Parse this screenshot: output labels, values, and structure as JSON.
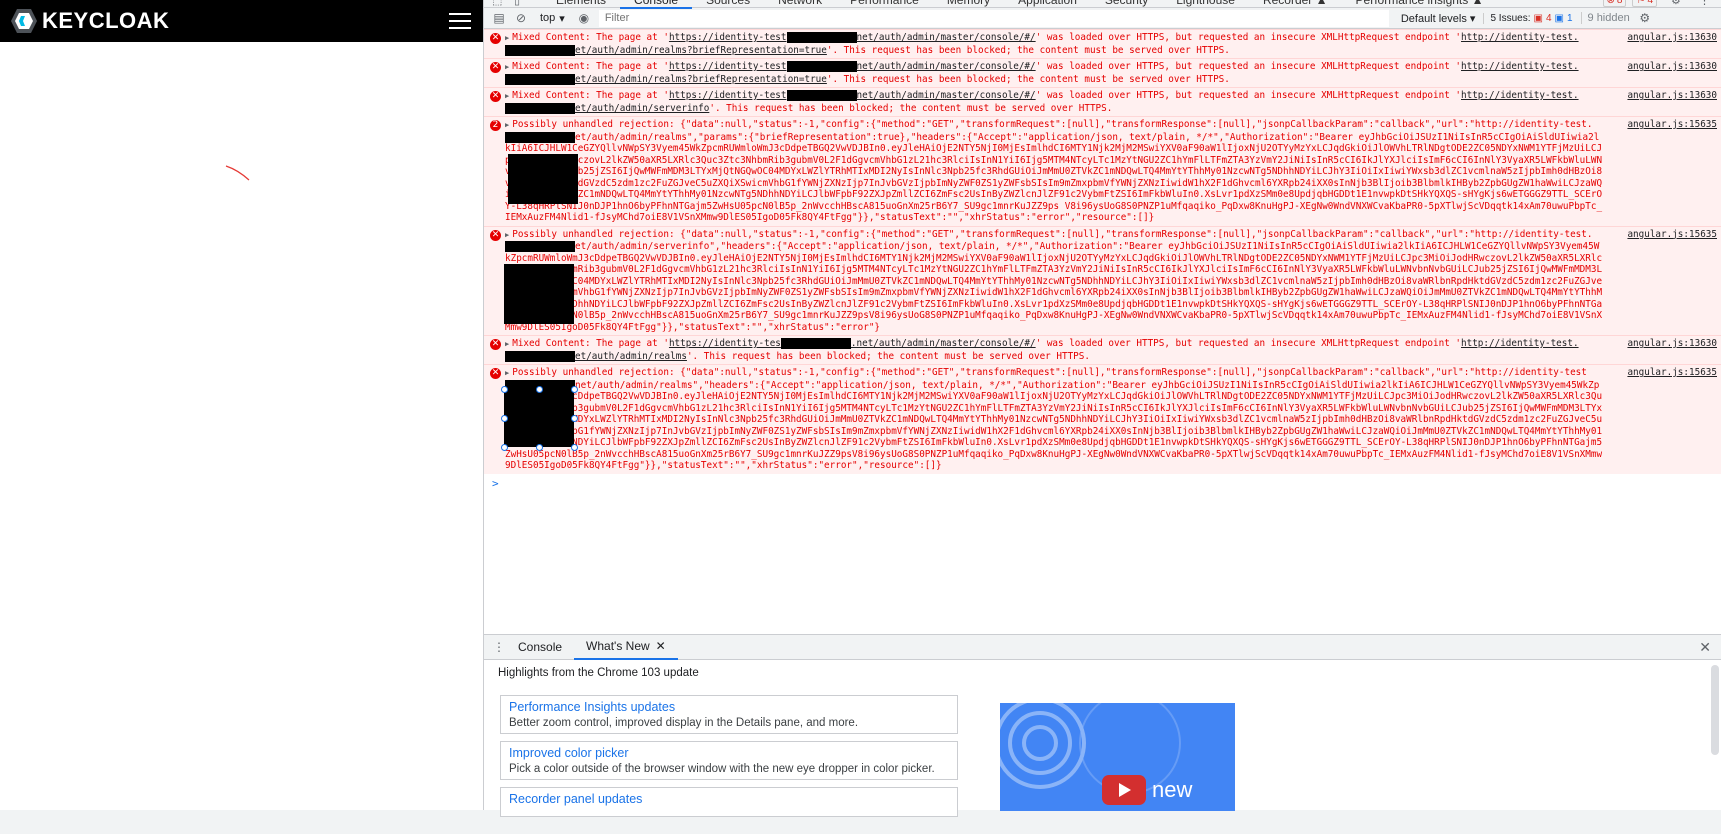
{
  "app": {
    "brand": "KEYCLOAK"
  },
  "devtools": {
    "tabs": [
      "Elements",
      "Console",
      "Sources",
      "Network",
      "Performance",
      "Memory",
      "Application",
      "Security",
      "Lighthouse",
      "Recorder ▲",
      "Performance insights ▲"
    ],
    "active_tab": "Console",
    "error_count": "8",
    "warning_count": "4",
    "toolbar": {
      "context": "top",
      "filter_placeholder": "Filter",
      "levels": "Default levels",
      "issues_label": "5 Issues:",
      "issues_errors": "4",
      "issues_info": "1",
      "hidden": "9 hidden"
    },
    "messages": [
      {
        "type": "error",
        "text_a": "Mixed Content: The page at '",
        "url_a": "https://identity-test",
        "url_b": "net/auth/admin/master/console/#/",
        "text_b": "' was loaded over HTTPS, but requested an insecure XMLHttpRequest endpoint '",
        "url_c": "http://identity-test.",
        "url_d": "et/auth/admin/realms?briefRepresentation=true",
        "text_c": "'. This request has been blocked; the content must be served over HTTPS.",
        "source": "angular.js:13630"
      },
      {
        "type": "error",
        "text_a": "Mixed Content: The page at '",
        "url_a": "https://identity-test",
        "url_b": "net/auth/admin/master/console/#/",
        "text_b": "' was loaded over HTTPS, but requested an insecure XMLHttpRequest endpoint '",
        "url_c": "http://identity-test.",
        "url_d": "et/auth/admin/realms?briefRepresentation=true",
        "text_c": "'. This request has been blocked; the content must be served over HTTPS.",
        "source": "angular.js:13630"
      },
      {
        "type": "error",
        "text_a": "Mixed Content: The page at '",
        "url_a": "https://identity-test",
        "url_b": "net/auth/admin/master/console/#/",
        "text_b": "' was loaded over HTTPS, but requested an insecure XMLHttpRequest endpoint '",
        "url_c": "http://identity-test.",
        "url_d": "et/auth/admin/serverinfo",
        "text_c": "'. This request has been blocked; the content must be served over HTTPS.",
        "source": "angular.js:13630"
      },
      {
        "type": "rejection",
        "repeat": "2",
        "head": "Possibly unhandled rejection: {\"data\":null,\"status\":-1,\"config\":{\"method\":\"GET\",\"transformRequest\":[null],\"transformResponse\":[null],\"jsonpCallbackParam\":\"callback\",\"url\":\"http://identity-test.",
        "mid": "et/auth/admin/realms\",\"params\":{\"briefRepresentation\":true},\"headers\":{\"Accept\":\"application/json, text/plain, */*\",\"Authorization\":\"Bearer eyJhbGciOiJSUzI1NiIsInR5cCIgOiAiSldUIiwia2lkIiA6ICJHLW1CeGZYQllvNWpSY3Vyem45WkZpcmRUWmloWmJ3cDdpeTBGQ2VwVDJBIn0.eyJleHAiOjE2NTY5NjI0MjEsImlhdCI6MTY1Njk2MjM2MSwiYXV0aF90aW1lIjoxNjU2OTYyMzYxLCJqdGkiOiJlOWVhLTRlNDgtODE2ZC05NDYxNWM1YTFjMzUiLCJpc3MiOiJodHRwczovL2lkZW50aXR5LXRlc3Quc3Ztc3NhbmRib3gubmV0L2F1dGgvcmVhbG1zL21hc3RlciIsInN1YiI6Ijg5MTM4NTcyLTc1MzYtNGU2ZC1hYmFlLTFmZTA3YzVmY2JiNiIsInR5cCI6IkJlYXJlciIsImF6cCI6InNlY3VyaXR5LWFkbWluLWNvbnNvbGUiLCJub25jZSI6IjQwMWFmMDM3LTYxMjQtNGQwOC04MDYxLWZlYTRhMTIxMDI2NyIsInNlc3Npb25fc3RhdGUiOiJmMmU0ZTVkZC1mNDQwLTQ4MmYtYThhMy01NzcwNTg5NDhhNDYiLCJhY3IiOiIxIiwiYWxsb3dlZC1vcmlnaW5zIjpbImh0dHBzOi8vaWRlbnRpdHktdGVzdC5zdm1zc2FuZGJveC5uZXQiXSwicmVhbG1fYWNjZXNzIjp7InJvbGVzIjpbImNyZWF0ZS1yZWFsbSIsIm9mZmxpbmVfYWNjZXNzIiwidW1hX2F1dGhvcml6YXRpb24iXX0sInNjb3BlIjoib3BlbmlkIHByb2ZpbGUgZW1haWwiLCJzaWQiOiJmMmU0ZTVkZC1mNDQwLTQ4MmYtYThhMy01NzcwNTg5NDhhNDYiLCJlbWFpbF92ZXJpZmllZCI6ZmFsc2UsInByZWZlcnJlZF91c2VybmFtZSI6ImFkbWluIn0.XsLvr1pdXzSMm0e8Updjqb",
        "tail": "HGDDt1E1nvwpkDtSHkYQXQS-sHYgKjs6wETGGGZ9TTL_SCErOY-L38qHRPlSNIJ0nDJP1hnO6byPFhnNTGajm5ZwHsU05pcN0lB5p_2nWvcchHBscA815uoGnXm25rB6Y7_SU9gc1mnrKuJZZ9ps V8i96ysUoG8S0PNZP1uMfqaqiko_PqDxw8KnuHgPJ-XEgNw0WndVNXWCvaKbaPR0-5pXTlwjScVDqqtk14xAm70uwuPbpTc_IEMxAuzFM4Nlid1-fJsyMChd7oiE8V1VSnXMmw9DlES05IgoD05Fk8QY4FtFgg\"}},\"statusText\":\"\",\"xhrStatus\":\"error\",\"resource\":[]}",
        "source": "angular.js:15635"
      },
      {
        "type": "rejection",
        "repeat": "",
        "head": "Possibly unhandled rejection: {\"data\":null,\"status\":-1,\"config\":{\"method\":\"GET\",\"transformRequest\":[null],\"transformResponse\":[null],\"jsonpCallbackParam\":\"callback\",\"url\":\"http://identity-test.",
        "mid": "et/auth/admin/serverinfo\",\"headers\":{\"Accept\":\"application/json, text/plain, */*\",\"Authorization\":\"Bearer eyJhbGciOiJSUzI1NiIsInR5cCIgOiAiSldUIiwia2lkIiA6ICJHLW1CeGZYQllvNWpSY3Vyem45WkZpcmRUWmloWmJ3cDdpeTBGQ2VwVDJBIn0.eyJleHAiOjE2NTY5NjI0MjEsImlhdCI6MTY1Njk2MjM2MSwiYXV0aF90aW1lIjoxNjU2OTYyMzYxLCJqdGkiOiJlOWVhLTRlNDgtODE2ZC05NDYxNWM1YTFjMzUiLCJpc3MiOiJodHRwczovL2lkZW50aXR5LXRlc3Quc3Ztc3NhbmRib3gubmV0L2F1dGgvcmVhbG1zL21hc3RlciIsInN1YiI6Ijg5MTM4NTcyLTc1MzYtNGU2ZC1hYmFlLTFmZTA3YzVmY2JiNiIsInR5cCI6IkJlYXJlciIsImF6cCI6InNlY3VyaXR5LWFkbWluLWNvbnNvbGUiLCJub25jZSI6IjQwMWFmMDM3LTYxMjQtNGQwOC04MDYxLWZlYTRhMTIxMDI2NyIsInNlc3Npb25fc3RhdGUiOiJmMmU0ZTVkZC1mNDQwLTQ4MmYtYThhMy01NzcwNTg5NDhhNDYiLCJhY3IiOiIxIiwiYWxsb3dlZC1vcmlnaW5zIjpbImh0dHBzOi8vaWRlbnRpdHktdGVzdC5zdm1zc2FuZGJveC5uZXQiXSwicmVhbG1fYWNjZXNzIjp7InJvbGVzIjpbImNyZWF0ZS1yZWFsbSIsIm9mZmxpbmVfYWNjZXNzIiwidW1hX2F1dGhvcml6YXRpb24iXX0sInNjb3BlIjoib3BlbmlkIHByb2ZpbGUgZW1haWwiLCJzaWQiOiJmMmU0ZTVkZC1mNDQwLTQ4MmYtYThhMy01NzcwNTg5NDhhNDYiLCJlbWFpbF92ZXJpZmllZCI6ZmFsc2UsInByZWZlcnJlZF91c2VybmFtZSI6ImFkbWluIn0.XsLvr1pdXzSMm0e8Updjqb",
        "tail": "HGDDt1E1nvwpkDtSHkYQXQS-sHYgKjs6wETGGGZ9TTL_SCErOY-L38qHRPlSNIJ0nDJP1hnO6byPFhnNTGajm5ZwHsU05pcN0lB5p_2nWvcchHBscA815uoGnXm25rB6Y7_SU9gc1mnrKuJZZ9psV8i96ysUoG8S0PNZP1uMfqaqiko_PqDxw8KnuHgPJ-XEgNw0WndVNXWCvaKbaPR0-5pXTlwjScVDqqtk14xAm70uwuPbpTc_IEMxAuzFM4Nlid1-fJsyMChd7oiE8V1VSnXMmw9DlES05IgoD05Fk8QY4FtFgg\"}},\"statusText\":\"\",\"xhrStatus\":\"error\"}",
        "source": "angular.js:15635"
      },
      {
        "type": "error",
        "text_a": "Mixed Content: The page at '",
        "url_a": "https://identity-tes",
        "url_b": ".net/auth/admin/master/console/#/",
        "text_b": "' was loaded over HTTPS, but requested an insecure XMLHttpRequest endpoint '",
        "url_c": "http://identity-test.",
        "url_d": "et/auth/admin/realms",
        "text_c": "'. This request has been blocked; the content must be served over HTTPS.",
        "source": "angular.js:13630"
      },
      {
        "type": "rejection",
        "repeat": "",
        "head": "Possibly unhandled rejection: {\"data\":null,\"status\":-1,\"config\":{\"method\":\"GET\",\"transformRequest\":[null],\"transformResponse\":[null],\"jsonpCallbackParam\":\"callback\",\"url\":\"http://identity-test",
        "mid": "net/auth/admin/realms\",\"headers\":{\"Accept\":\"application/json, text/plain, */*\",\"Authorization\":\"Bearer eyJhbGciOiJSUzI1NiIsInR5cCIgOiAiSldUIiwia2lkIiA6ICJHLW1CeGZYQllvNWpSY3Vyem45WkZpcmRUWmloWmJ3cDdpeTBGQ2VwVDJBIn0.eyJleHAiOjE2NTY5NjI0MjEsImlhdCI6MTY1Njk2MjM2MSwiYXV0aF90aW1lIjoxNjU2OTYyMzYxLCJqdGkiOiJlOWVhLTRlNDgtODE2ZC05NDYxNWM1YTFjMzUiLCJpc3MiOiJodHRwczovL2lkZW50aXR5LXRlc3Quc3Ztc3NhbmRib3gubmV0L2F1dGgvcmVhbG1zL21hc3RlciIsInN1YiI6Ijg5MTM4NTcyLTc1MzYtNGU2ZC1hYmFlLTFmZTA3YzVmY2JiNiIsInR5cCI6IkJlYXJlciIsImF6cCI6InNlY3VyaXR5LWFkbWluLWNvbnNvbGUiLCJub25jZSI6IjQwMWFmMDM3LTYxMjQtNGQwOC04MDYxLWZlYTRhMTIxMDI2NyIsInNlc3Npb25fc3RhdGUiOiJmMmU0ZTVkZC1mNDQwLTQ4MmYtYThhMy01NzcwNTg5NDhhNDYiLCJhY3IiOiIxIiwiYWxsb3dlZC1vcmlnaW5zIjpbImh0dHBzOi8vaWRlbnRpdHktdGVzdC5zdm1zc2FuZGJveC5uZXQiXSwicmVhbG1fYWNjZXNzIjp7InJvbGVzIjpbImNyZWF0ZS1yZWFsbSIsIm9mZmxpbmVfYWNjZXNzIiwidW1hX2F1dGhvcml6YXRpb24iXX0sInNjb3BlIjoib3BlbmlkIHByb2ZpbGUgZW1haWwiLCJzaWQiOiJmMmU0ZTVkZC1mNDQwLTQ4MmYtYThhMy01NzcwNTg5NDhhNDYiLCJlbWFpbF92ZXJpZmllZCI6ZmFsc2UsInByZWZlcnJlZF91c2VybmFtZSI6ImFkbWluIn0.XsLvr1pdXzSMm0e8Updjqb",
        "tail": "HGDDt1E1nvwpkDtSHkYQXQS-sHYgKjs6wETGGGZ9TTL_SCErOY-L38qHRPlSNIJ0nDJP1hnO6byPFhnNTGajm5ZwHsU05pcN0lB5p_2nWvcchHBscA815uoGnXm25rB6Y7_SU9gc1mnrKuJZZ9psV8i96ysUoG8S0PNZP1uMfqaqiko_PqDxw8KnuHgPJ-XEgNw0WndVNXWCvaKbaPR0-5pXTlwjScVDqqtk14xAm70uwuPbpTc_IEMxAuzFM4Nlid1-fJsyMChd7oiE8V1VSnXMmw9DlES05IgoD05Fk8QY4FtFgg\"}},\"statusText\":\"\",\"xhrStatus\":\"error\",\"resource\":[]}",
        "source": "angular.js:15635"
      }
    ],
    "prompt": ">"
  },
  "drawer": {
    "tabs": [
      "Console",
      "What's New"
    ],
    "active_tab": "What's New",
    "title": "Highlights from the Chrome 103 update",
    "cards": [
      {
        "title": "Performance Insights updates",
        "desc": "Better zoom control, improved display in the Details pane, and more."
      },
      {
        "title": "Improved color picker",
        "desc": "Pick a color outside of the browser window with the new eye dropper in color picker."
      },
      {
        "title": "Recorder panel updates",
        "desc": ""
      }
    ],
    "video_label": "new"
  }
}
